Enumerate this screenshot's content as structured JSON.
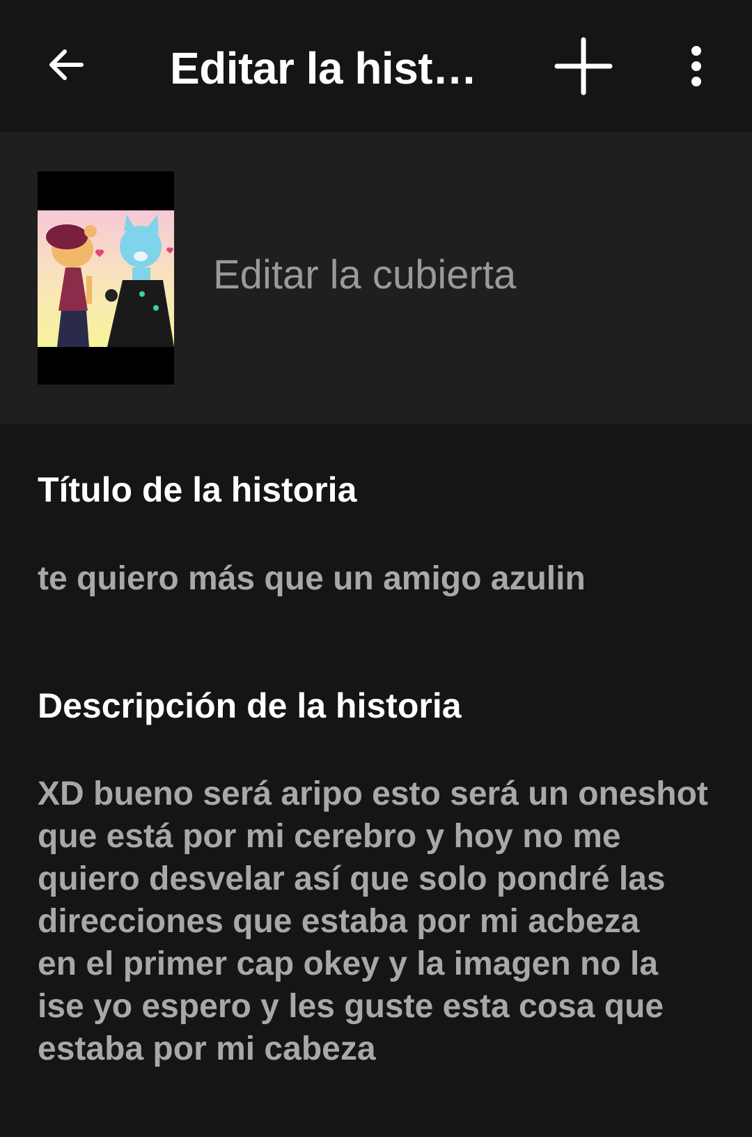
{
  "appbar": {
    "title": "Editar la historia",
    "back_icon": "arrow-left-icon",
    "add_icon": "plus-icon",
    "more_icon": "more-vertical-icon"
  },
  "cover": {
    "label": "Editar la cubierta"
  },
  "story": {
    "title_label": "Título de la historia",
    "title_value": "te quiero más que un amigo azulin",
    "description_label": "Descripción de la historia",
    "description_value": "XD bueno será aripo esto será un oneshot\nque está por mi cerebro y hoy no me\nquiero desvelar así que solo pondré las\ndirecciones que estaba por mi acbeza\nen el primer cap okey y la imagen no la\nise yo espero y les guste esta cosa que\nestaba por mi cabeza"
  },
  "colors": {
    "background": "#151515",
    "cover_section": "#1f1f1f",
    "label_text": "#ffffff",
    "value_text": "#a8a8a8",
    "hint_text": "#9a9a9a"
  }
}
